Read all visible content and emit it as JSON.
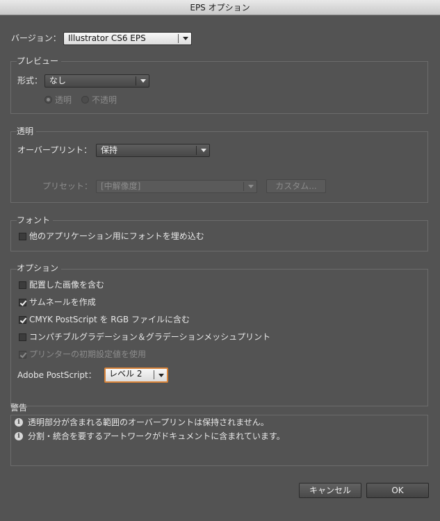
{
  "window": {
    "title": "EPS オプション"
  },
  "version": {
    "label": "バージョン：",
    "value": "Illustrator CS6 EPS"
  },
  "preview": {
    "group_title": "プレビュー",
    "format_label": "形式：",
    "format_value": "なし",
    "radio_transparent": "透明",
    "radio_opaque": "不透明"
  },
  "transparency": {
    "group_title": "透明",
    "overprint_label": "オーバープリント：",
    "overprint_value": "保持",
    "preset_label": "プリセット：",
    "preset_value": "[中解像度]",
    "custom_button": "カスタム..."
  },
  "fonts": {
    "group_title": "フォント",
    "embed_label": "他のアプリケーション用にフォントを埋め込む",
    "embed_checked": false
  },
  "options": {
    "group_title": "オプション",
    "items": [
      {
        "label": "配置した画像を含む",
        "checked": false,
        "disabled": false
      },
      {
        "label": "サムネールを作成",
        "checked": true,
        "disabled": false
      },
      {
        "label": "CMYK PostScript を RGB ファイルに含む",
        "checked": true,
        "disabled": false
      },
      {
        "label": "コンパチブルグラデーション＆グラデーションメッシュプリント",
        "checked": false,
        "disabled": false
      },
      {
        "label": "プリンターの初期設定値を使用",
        "checked": true,
        "disabled": true
      }
    ],
    "postscript_label": "Adobe PostScript：",
    "postscript_value": "レベル 2"
  },
  "warnings": {
    "title": "警告",
    "items": [
      "透明部分が含まれる範囲のオーバープリントは保持されません。",
      "分割・統合を要するアートワークがドキュメントに含まれています。"
    ],
    "icon": "info-icon"
  },
  "buttons": {
    "cancel": "キャンセル",
    "ok": "OK"
  }
}
